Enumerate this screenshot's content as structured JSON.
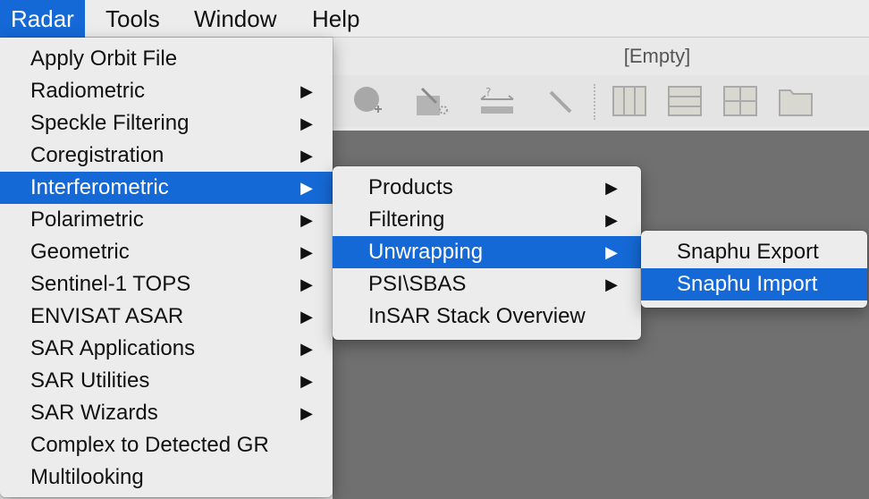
{
  "menubar": {
    "items": [
      {
        "label": "Radar",
        "active": true
      },
      {
        "label": "Tools"
      },
      {
        "label": "Window"
      },
      {
        "label": "Help"
      }
    ]
  },
  "window": {
    "title": "[Empty]"
  },
  "toolbar": {
    "icons": [
      "add-circle-icon",
      "select-tool-icon",
      "range-finder-icon",
      "magic-wand-icon",
      "tile-columns-icon",
      "tile-rows-icon",
      "tile-grid-icon",
      "tile-single-icon"
    ]
  },
  "radar_menu": {
    "items": [
      {
        "label": "Apply Orbit File"
      },
      {
        "label": "Radiometric",
        "submenu": true
      },
      {
        "label": "Speckle Filtering",
        "submenu": true
      },
      {
        "label": "Coregistration",
        "submenu": true
      },
      {
        "label": "Interferometric",
        "submenu": true,
        "selected": true
      },
      {
        "label": "Polarimetric",
        "submenu": true
      },
      {
        "label": "Geometric",
        "submenu": true
      },
      {
        "label": "Sentinel-1 TOPS",
        "submenu": true
      },
      {
        "label": "ENVISAT ASAR",
        "submenu": true
      },
      {
        "label": "SAR Applications",
        "submenu": true
      },
      {
        "label": "SAR Utilities",
        "submenu": true
      },
      {
        "label": "SAR Wizards",
        "submenu": true
      },
      {
        "label": "Complex to Detected GR"
      },
      {
        "label": "Multilooking"
      }
    ]
  },
  "interferometric_menu": {
    "items": [
      {
        "label": "Products",
        "submenu": true
      },
      {
        "label": "Filtering",
        "submenu": true
      },
      {
        "label": "Unwrapping",
        "submenu": true,
        "selected": true
      },
      {
        "label": "PSI\\SBAS",
        "submenu": true
      },
      {
        "label": "InSAR Stack Overview"
      }
    ]
  },
  "unwrapping_menu": {
    "items": [
      {
        "label": "Snaphu Export"
      },
      {
        "label": "Snaphu Import",
        "selected": true
      }
    ]
  },
  "arrow_glyph": "▶",
  "colors": {
    "selection": "#1569d6",
    "menu_bg": "#ececec",
    "workspace": "#707070"
  }
}
